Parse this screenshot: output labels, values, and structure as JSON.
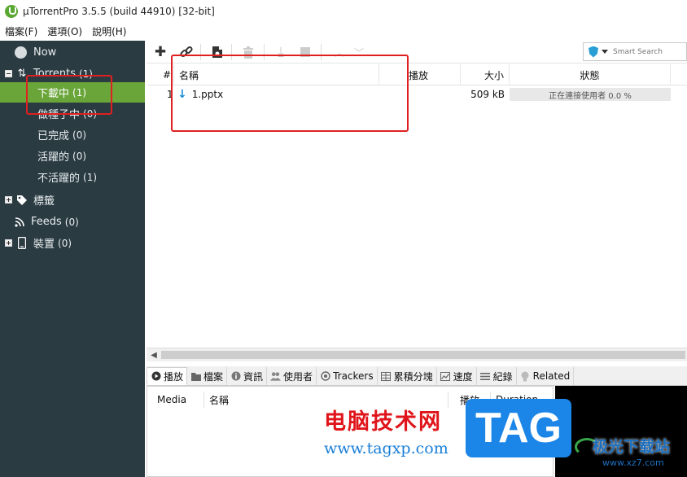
{
  "window": {
    "title": "µTorrentPro 3.5.5  (build 44910) [32-bit]"
  },
  "menu": {
    "items": [
      "檔案(F)",
      "選項(O)",
      "說明(H)"
    ]
  },
  "sidebar": {
    "now": "Now",
    "torrents": {
      "label": "Torrents",
      "count": "(1)"
    },
    "items": [
      {
        "label": "下載中",
        "count": "(1)"
      },
      {
        "label": "做種子中",
        "count": "(0)"
      },
      {
        "label": "已完成",
        "count": "(0)"
      },
      {
        "label": "活躍的",
        "count": "(0)"
      },
      {
        "label": "不活躍的",
        "count": "(1)"
      }
    ],
    "labels": "標籤",
    "feeds": {
      "label": "Feeds",
      "count": "(0)"
    },
    "devices": {
      "label": "裝置",
      "count": "(0)"
    }
  },
  "toolbar": {
    "search_placeholder": "Smart Search",
    "icons": [
      "add-icon",
      "link-icon",
      "create-icon",
      "delete-icon",
      "download-icon",
      "stop-icon",
      "up-icon",
      "down-icon"
    ]
  },
  "list": {
    "columns": {
      "num": "#",
      "name": "名稱",
      "play": "播放",
      "size": "大小",
      "status": "狀態"
    },
    "rows": [
      {
        "num": "1",
        "name": "1.pptx",
        "size": "509 kB",
        "status": "正在連接使用者 0.0 %"
      }
    ]
  },
  "tabs": [
    "播放",
    "檔案",
    "資訊",
    "使用者",
    "Trackers",
    "累積分塊",
    "速度",
    "紀錄",
    "Related"
  ],
  "detail": {
    "columns": {
      "media": "Media",
      "name": "名稱",
      "play": "播放",
      "duration": "Duration"
    }
  },
  "watermark": {
    "cn": "电脑技术网",
    "url": "www.tagxp.com",
    "tag": "TAG",
    "site": "极光下载站",
    "site_url": "www.xz7.com"
  },
  "colors": {
    "sidebar_bg": "#2b3b42",
    "selected": "#6aa53a",
    "annotation": "#e02020"
  }
}
